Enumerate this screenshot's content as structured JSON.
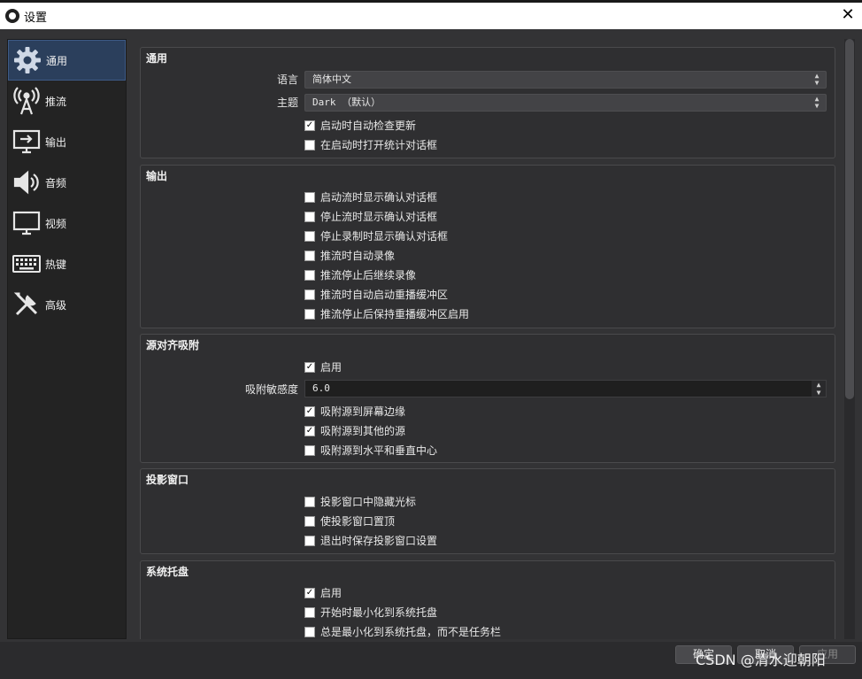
{
  "window": {
    "title": "设置"
  },
  "sidebar": {
    "items": [
      {
        "label": "通用",
        "icon": "gear-icon"
      },
      {
        "label": "推流",
        "icon": "broadcast-antenna-icon"
      },
      {
        "label": "输出",
        "icon": "output-monitor-icon"
      },
      {
        "label": "音频",
        "icon": "speaker-icon"
      },
      {
        "label": "视频",
        "icon": "monitor-icon"
      },
      {
        "label": "热键",
        "icon": "keyboard-icon"
      },
      {
        "label": "高级",
        "icon": "tools-icon"
      }
    ],
    "active_index": 0
  },
  "general": {
    "title": "通用",
    "language_label": "语言",
    "language_value": "简体中文",
    "theme_label": "主题",
    "theme_value": "Dark （默认）",
    "check_updates": {
      "label": "启动时自动检查更新",
      "checked": true
    },
    "stats_dialog": {
      "label": "在启动时打开统计对话框",
      "checked": false
    }
  },
  "output": {
    "title": "输出",
    "items": [
      {
        "label": "启动流时显示确认对话框",
        "checked": false
      },
      {
        "label": "停止流时显示确认对话框",
        "checked": false
      },
      {
        "label": "停止录制时显示确认对话框",
        "checked": false
      },
      {
        "label": "推流时自动录像",
        "checked": false
      },
      {
        "label": "推流停止后继续录像",
        "checked": false
      },
      {
        "label": "推流时自动启动重播缓冲区",
        "checked": false
      },
      {
        "label": "推流停止后保持重播缓冲区启用",
        "checked": false
      }
    ]
  },
  "snapping": {
    "title": "源对齐吸附",
    "enable": {
      "label": "启用",
      "checked": true
    },
    "sensitivity_label": "吸附敏感度",
    "sensitivity_value": "6.0",
    "items": [
      {
        "label": "吸附源到屏幕边缘",
        "checked": true
      },
      {
        "label": "吸附源到其他的源",
        "checked": true
      },
      {
        "label": "吸附源到水平和垂直中心",
        "checked": false
      }
    ]
  },
  "projector": {
    "title": "投影窗口",
    "items": [
      {
        "label": "投影窗口中隐藏光标",
        "checked": false
      },
      {
        "label": "使投影窗口置顶",
        "checked": false
      },
      {
        "label": "退出时保存投影窗口设置",
        "checked": false
      }
    ]
  },
  "tray": {
    "title": "系统托盘",
    "items": [
      {
        "label": "启用",
        "checked": true
      },
      {
        "label": "开始时最小化到系统托盘",
        "checked": false
      },
      {
        "label": "总是最小化到系统托盘，而不是任务栏",
        "checked": false
      }
    ]
  },
  "buttons": {
    "ok": "确定",
    "cancel": "取消",
    "apply": "应用"
  },
  "watermark": "CSDN @清水迎朝阳"
}
